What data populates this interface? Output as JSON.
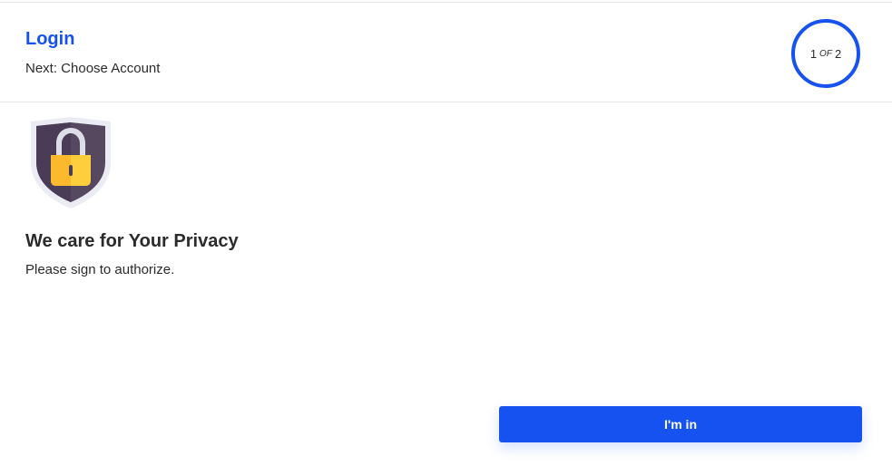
{
  "header": {
    "title": "Login",
    "next": "Next: Choose Account",
    "progress": {
      "current": "1",
      "of": "OF",
      "total": "2"
    }
  },
  "main": {
    "icon": "shield-lock-icon",
    "title": "We care for Your Privacy",
    "description": "Please sign to authorize."
  },
  "actions": {
    "primary_label": "I'm in"
  },
  "colors": {
    "accent": "#1652f0",
    "text": "#2b2b2b",
    "shield_dark": "#4a3c56",
    "lock_yellow": "#fdb92e"
  }
}
